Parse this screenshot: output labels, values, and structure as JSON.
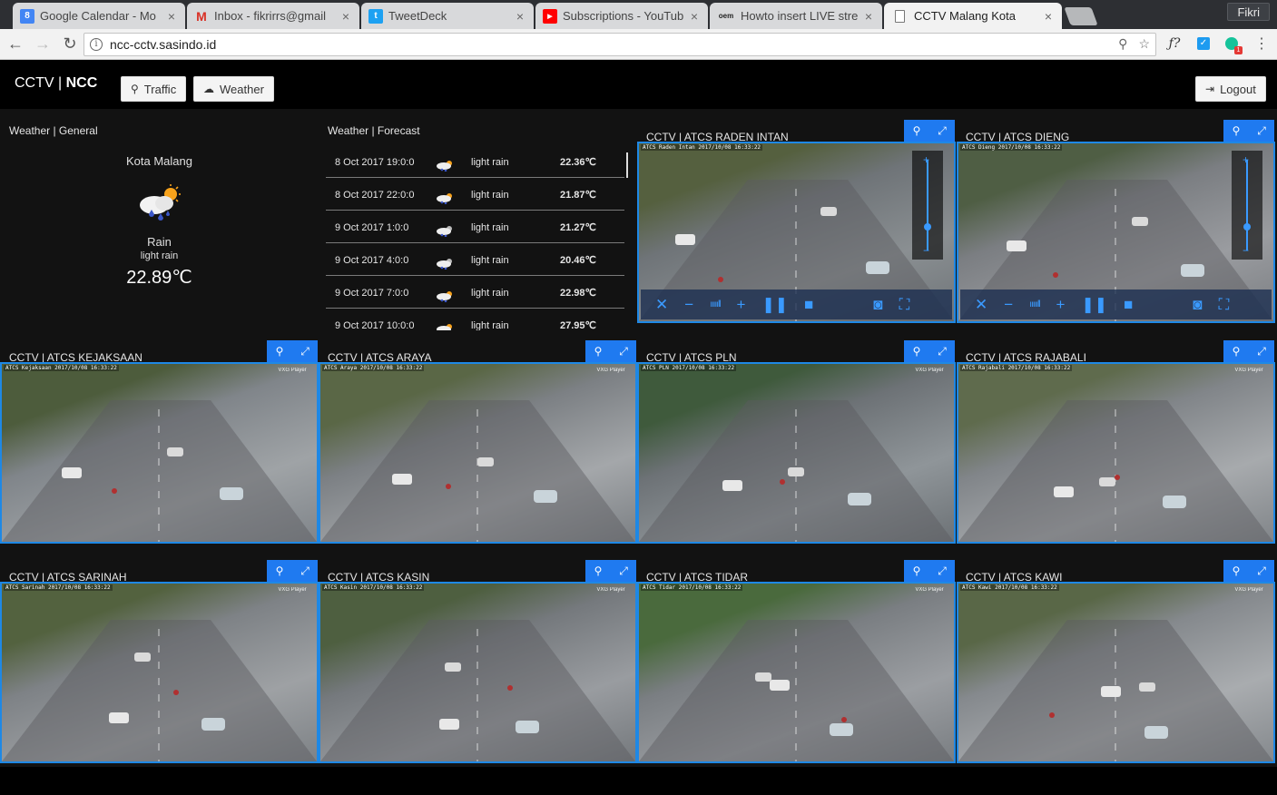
{
  "browser": {
    "tabs": [
      {
        "title": "Google Calendar - Mo",
        "icon": "calendar-icon",
        "color": "#4285f4",
        "glyph": "8"
      },
      {
        "title": "Inbox - fikrirrs@gmail",
        "icon": "gmail-icon",
        "color": "#d93025",
        "glyph": "M"
      },
      {
        "title": "TweetDeck",
        "icon": "tweetdeck-icon",
        "color": "#1da1f2",
        "glyph": "t"
      },
      {
        "title": "Subscriptions - YouTub",
        "icon": "youtube-icon",
        "color": "#ff0000",
        "glyph": "▶"
      },
      {
        "title": "Howto insert LIVE stre",
        "icon": "oem-icon",
        "color": "#555555",
        "glyph": "oem"
      },
      {
        "title": "CCTV Malang Kota",
        "icon": "page-icon",
        "color": "#ffffff",
        "glyph": ""
      }
    ],
    "profile": "Fikri",
    "url": "ncc-cctv.sasindo.id"
  },
  "header": {
    "brand_prefix": "CCTV | ",
    "brand_bold": "NCC",
    "traffic": "Traffic",
    "weather": "Weather",
    "logout": "Logout"
  },
  "weather_general": {
    "title": "Weather | General",
    "city": "Kota Malang",
    "main": "Rain",
    "desc": "light rain",
    "temp": "22.89℃"
  },
  "forecast": {
    "title": "Weather | Forecast",
    "rows": [
      {
        "date": "8 Oct 2017 19:0:0",
        "desc": "light rain",
        "temp": "22.36℃"
      },
      {
        "date": "8 Oct 2017 22:0:0",
        "desc": "light rain",
        "temp": "21.87℃"
      },
      {
        "date": "9 Oct 2017 1:0:0",
        "desc": "light rain",
        "temp": "21.27℃"
      },
      {
        "date": "9 Oct 2017 4:0:0",
        "desc": "light rain",
        "temp": "20.46℃"
      },
      {
        "date": "9 Oct 2017 7:0:0",
        "desc": "light rain",
        "temp": "22.98℃"
      },
      {
        "date": "9 Oct 2017 10:0:0",
        "desc": "light rain",
        "temp": "27.95℃"
      }
    ]
  },
  "cameras": [
    {
      "title": "CCTV | ATCS RADEN INTAN",
      "stamp": "ATCS Raden Intan 2017/10/08 16:33:22",
      "controls": true
    },
    {
      "title": "CCTV | ATCS DIENG",
      "stamp": "ATCS Dieng 2017/10/08 16:33:22",
      "controls": true
    },
    {
      "title": "CCTV | ATCS KEJAKSAAN",
      "stamp": "ATCS Kejaksaan 2017/10/08 16:33:22",
      "controls": false
    },
    {
      "title": "CCTV | ATCS ARAYA",
      "stamp": "ATCS Araya 2017/10/08 16:33:22",
      "controls": false
    },
    {
      "title": "CCTV | ATCS PLN",
      "stamp": "ATCS PLN 2017/10/08 16:33:22",
      "controls": false
    },
    {
      "title": "CCTV | ATCS RAJABALI",
      "stamp": "ATCS Rajabali 2017/10/08 16:33:22",
      "controls": false
    },
    {
      "title": "CCTV | ATCS SARINAH",
      "stamp": "ATCS Sarinah 2017/10/08 16:33:22",
      "controls": false
    },
    {
      "title": "CCTV | ATCS KASIN",
      "stamp": "ATCS Kasin 2017/10/08 16:33:22",
      "controls": false
    },
    {
      "title": "CCTV | ATCS TIDAR",
      "stamp": "ATCS Tidar 2017/10/08 16:33:22",
      "controls": false
    },
    {
      "title": "CCTV | ATCS KAWI",
      "stamp": "ATCS Kawi 2017/10/08 16:33:22",
      "controls": false
    }
  ],
  "player_badge": "VXG Player",
  "colors": {
    "accent": "#1f7af0",
    "border": "#1e88e5",
    "bg": "#121212"
  }
}
